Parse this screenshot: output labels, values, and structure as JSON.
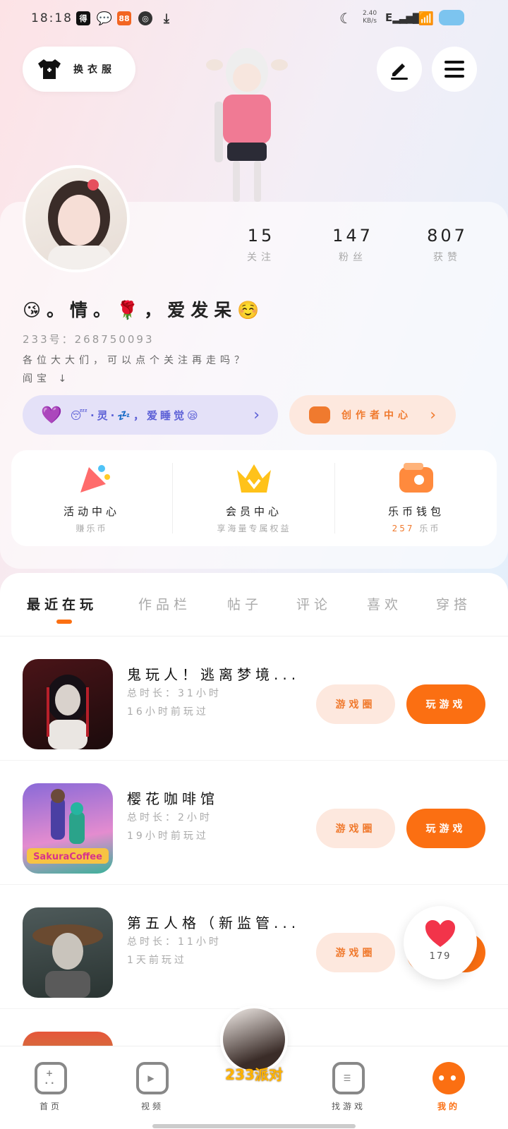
{
  "status_bar": {
    "time": "18:18",
    "speed": "2.40",
    "speed_unit": "KB/s",
    "network": "E"
  },
  "top": {
    "outfit_label": "换衣服"
  },
  "profile": {
    "stats": [
      {
        "value": "15",
        "label": "关注"
      },
      {
        "value": "147",
        "label": "粉丝"
      },
      {
        "value": "807",
        "label": "获赞"
      }
    ],
    "name": "😘。情。🌹，爱发呆☺️",
    "id_line": "233号：268750093",
    "bio_line1": "各位大大们，可以点个关注再走吗？",
    "bio_line2": "阎宝 ↓",
    "tag_text": "😴·灵·💤，爱睡觉😪",
    "creator_label": "创作者中心"
  },
  "quick": [
    {
      "title": "活动中心",
      "sub": "赚乐币"
    },
    {
      "title": "会员中心",
      "sub": "享海量专属权益"
    },
    {
      "title": "乐币钱包",
      "sub_value": "257",
      "sub_unit": "乐币"
    }
  ],
  "tabs": [
    "最近在玩",
    "作品栏",
    "帖子",
    "评论",
    "喜欢",
    "穿搭"
  ],
  "games": [
    {
      "title": "鬼玩人！逃离梦境...",
      "duration": "总时长：31小时",
      "last": "16小时前玩过"
    },
    {
      "title": "樱花咖啡馆",
      "duration": "总时长：2小时",
      "last": "19小时前玩过"
    },
    {
      "title": "第五人格（新监管...",
      "duration": "总时长：11小时",
      "last": "1天前玩过"
    }
  ],
  "buttons": {
    "circle": "游戏圈",
    "play": "玩游戏"
  },
  "like_count": "179",
  "thumb_labels": {
    "sakura": "SakuraCoffee"
  },
  "bottom_nav": [
    {
      "label": "首页"
    },
    {
      "label": "视频"
    },
    {
      "label": "233派对"
    },
    {
      "label": "找游戏"
    },
    {
      "label": "我的"
    }
  ],
  "colors": {
    "accent": "#fb6f12",
    "accent_light": "#fde8de",
    "purple": "#e4e1f8"
  }
}
